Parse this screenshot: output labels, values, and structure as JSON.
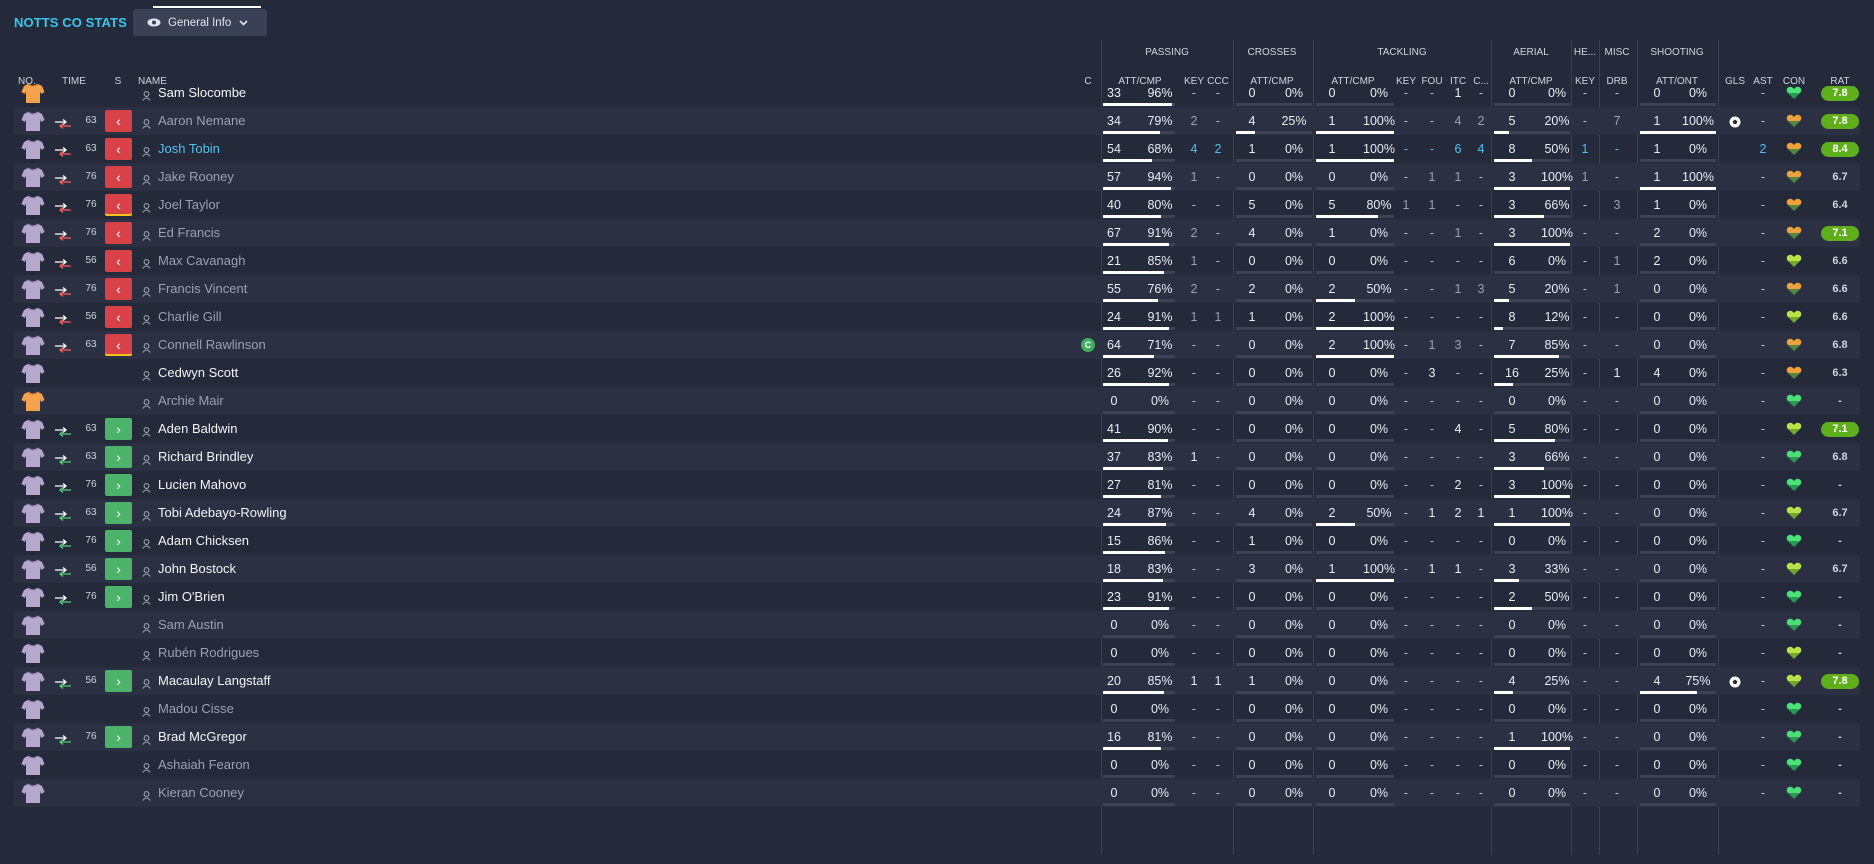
{
  "header": {
    "title": "NOTTS CO STATS",
    "view_label": "General Info"
  },
  "groups": [
    "PASSING",
    "CROSSES",
    "TACKLING",
    "AERIAL",
    "HE...",
    "MISC",
    "SHOOTING"
  ],
  "columns": {
    "no": "NO.",
    "time": "TIME",
    "s": "S",
    "name": "NAME",
    "c": "C",
    "pass_attcmp": "ATT/CMP",
    "key": "KEY",
    "ccc": "CCC",
    "cross_attcmp": "ATT/CMP",
    "tack_attcmp": "ATT/CMP",
    "tkey": "KEY",
    "fou": "FOU",
    "itc": "ITC",
    "cl": "C...",
    "aer_attcmp": "ATT/CMP",
    "hkey": "KEY",
    "drb": "DRB",
    "shot_attont": "ATT/ONT",
    "gls": "GLS",
    "ast": "AST",
    "con": "CON",
    "rat": "RAT"
  },
  "players": [
    {
      "name": "Sam Slocombe",
      "shirt": "orange",
      "status": "active",
      "arrow": "",
      "time": "",
      "sub": "",
      "captain": false,
      "p": [
        "33",
        "96%"
      ],
      "pk": "-",
      "pc": "-",
      "cr": [
        "0",
        "0%"
      ],
      "t": [
        "0",
        "0%"
      ],
      "tk": "-",
      "tf": "-",
      "ti": "1",
      "tc": "-",
      "a": [
        "0",
        "0%"
      ],
      "hk": "-",
      "md": "-",
      "s": [
        "0",
        "0%"
      ],
      "g": "",
      "as": "-",
      "con": "green",
      "rat": "7.8",
      "ratc": true,
      "pf": 0.96,
      "crf": 0,
      "tf2": 0,
      "af": 0,
      "sf": 0
    },
    {
      "name": "Aaron Nemane",
      "shirt": "lilac",
      "status": "dim",
      "arrow": "out",
      "time": "63",
      "sub": "off",
      "captain": false,
      "p": [
        "34",
        "79%"
      ],
      "pk": "2",
      "pc": "-",
      "cr": [
        "4",
        "25%"
      ],
      "t": [
        "1",
        "100%"
      ],
      "tk": "-",
      "tf": "-",
      "ti": "4",
      "tc": "2",
      "a": [
        "5",
        "20%"
      ],
      "hk": "-",
      "md": "7",
      "s": [
        "1",
        "100%"
      ],
      "g": "ball",
      "as": "-",
      "con": "orange",
      "rat": "7.8",
      "ratc": true,
      "pf": 0.79,
      "crf": 0.25,
      "tf2": 1,
      "af": 0.2,
      "sf": 1
    },
    {
      "name": "Josh Tobin",
      "shirt": "lilac",
      "status": "sel",
      "arrow": "out",
      "time": "63",
      "sub": "off",
      "captain": false,
      "p": [
        "54",
        "68%"
      ],
      "pk": "4",
      "pc": "2",
      "cr": [
        "1",
        "0%"
      ],
      "t": [
        "1",
        "100%"
      ],
      "tk": "-",
      "tf": "-",
      "ti": "6",
      "tc": "4",
      "a": [
        "8",
        "50%"
      ],
      "hk": "1",
      "md": "-",
      "s": [
        "1",
        "0%"
      ],
      "g": "",
      "as": "2",
      "con": "orange",
      "rat": "8.4",
      "ratc": true,
      "hl": true,
      "pf": 0.68,
      "crf": 0,
      "tf2": 1,
      "af": 0.5,
      "sf": 0
    },
    {
      "name": "Jake Rooney",
      "shirt": "lilac",
      "status": "dim",
      "arrow": "out",
      "time": "76",
      "sub": "off",
      "captain": false,
      "p": [
        "57",
        "94%"
      ],
      "pk": "1",
      "pc": "-",
      "cr": [
        "0",
        "0%"
      ],
      "t": [
        "0",
        "0%"
      ],
      "tk": "-",
      "tf": "1",
      "ti": "1",
      "tc": "-",
      "a": [
        "3",
        "100%"
      ],
      "hk": "1",
      "md": "-",
      "s": [
        "1",
        "100%"
      ],
      "g": "",
      "as": "-",
      "con": "orange",
      "rat": "6.7",
      "ratc": false,
      "pf": 0.94,
      "crf": 0,
      "tf2": 0,
      "af": 1,
      "sf": 1
    },
    {
      "name": "Joel Taylor",
      "shirt": "lilac",
      "status": "dim",
      "arrow": "out",
      "time": "76",
      "sub": "off yel",
      "captain": false,
      "p": [
        "40",
        "80%"
      ],
      "pk": "-",
      "pc": "-",
      "cr": [
        "5",
        "0%"
      ],
      "t": [
        "5",
        "80%"
      ],
      "tk": "1",
      "tf": "1",
      "ti": "-",
      "tc": "-",
      "a": [
        "3",
        "66%"
      ],
      "hk": "-",
      "md": "3",
      "s": [
        "1",
        "0%"
      ],
      "g": "",
      "as": "-",
      "con": "orange",
      "rat": "6.4",
      "ratc": false,
      "pf": 0.8,
      "crf": 0,
      "tf2": 0.8,
      "af": 0.66,
      "sf": 0
    },
    {
      "name": "Ed Francis",
      "shirt": "lilac",
      "status": "dim",
      "arrow": "out",
      "time": "76",
      "sub": "off",
      "captain": false,
      "p": [
        "67",
        "91%"
      ],
      "pk": "2",
      "pc": "-",
      "cr": [
        "4",
        "0%"
      ],
      "t": [
        "1",
        "0%"
      ],
      "tk": "-",
      "tf": "-",
      "ti": "1",
      "tc": "-",
      "a": [
        "3",
        "100%"
      ],
      "hk": "-",
      "md": "-",
      "s": [
        "2",
        "0%"
      ],
      "g": "",
      "as": "-",
      "con": "orange",
      "rat": "7.1",
      "ratc": true,
      "pf": 0.91,
      "crf": 0,
      "tf2": 0,
      "af": 1,
      "sf": 0
    },
    {
      "name": "Max Cavanagh",
      "shirt": "lilac",
      "status": "dim",
      "arrow": "out",
      "time": "56",
      "sub": "off",
      "captain": false,
      "p": [
        "21",
        "85%"
      ],
      "pk": "1",
      "pc": "-",
      "cr": [
        "0",
        "0%"
      ],
      "t": [
        "0",
        "0%"
      ],
      "tk": "-",
      "tf": "-",
      "ti": "-",
      "tc": "-",
      "a": [
        "6",
        "0%"
      ],
      "hk": "-",
      "md": "1",
      "s": [
        "2",
        "0%"
      ],
      "g": "",
      "as": "-",
      "con": "yellow",
      "rat": "6.6",
      "ratc": false,
      "pf": 0.85,
      "crf": 0,
      "tf2": 0,
      "af": 0,
      "sf": 0
    },
    {
      "name": "Francis Vincent",
      "shirt": "lilac",
      "status": "dim",
      "arrow": "out",
      "time": "76",
      "sub": "off",
      "captain": false,
      "p": [
        "55",
        "76%"
      ],
      "pk": "2",
      "pc": "-",
      "cr": [
        "2",
        "0%"
      ],
      "t": [
        "2",
        "50%"
      ],
      "tk": "-",
      "tf": "-",
      "ti": "1",
      "tc": "3",
      "a": [
        "5",
        "20%"
      ],
      "hk": "-",
      "md": "1",
      "s": [
        "0",
        "0%"
      ],
      "g": "",
      "as": "-",
      "con": "orange",
      "rat": "6.6",
      "ratc": false,
      "pf": 0.76,
      "crf": 0,
      "tf2": 0.5,
      "af": 0.2,
      "sf": 0
    },
    {
      "name": "Charlie Gill",
      "shirt": "lilac",
      "status": "dim",
      "arrow": "out",
      "time": "56",
      "sub": "off",
      "captain": false,
      "p": [
        "24",
        "91%"
      ],
      "pk": "1",
      "pc": "1",
      "cr": [
        "1",
        "0%"
      ],
      "t": [
        "2",
        "100%"
      ],
      "tk": "-",
      "tf": "-",
      "ti": "-",
      "tc": "-",
      "a": [
        "8",
        "12%"
      ],
      "hk": "-",
      "md": "-",
      "s": [
        "0",
        "0%"
      ],
      "g": "",
      "as": "-",
      "con": "yellow",
      "rat": "6.6",
      "ratc": false,
      "pf": 0.91,
      "crf": 0,
      "tf2": 1,
      "af": 0.12,
      "sf": 0
    },
    {
      "name": "Connell Rawlinson",
      "shirt": "lilac",
      "status": "dim",
      "arrow": "out",
      "time": "63",
      "sub": "off yel",
      "captain": true,
      "p": [
        "64",
        "71%"
      ],
      "pk": "-",
      "pc": "-",
      "cr": [
        "0",
        "0%"
      ],
      "t": [
        "2",
        "100%"
      ],
      "tk": "-",
      "tf": "1",
      "ti": "3",
      "tc": "-",
      "a": [
        "7",
        "85%"
      ],
      "hk": "-",
      "md": "-",
      "s": [
        "0",
        "0%"
      ],
      "g": "",
      "as": "-",
      "con": "orange",
      "rat": "6.8",
      "ratc": false,
      "pf": 0.71,
      "crf": 0,
      "tf2": 1,
      "af": 0.85,
      "sf": 0
    },
    {
      "name": "Cedwyn Scott",
      "shirt": "lilac",
      "status": "active",
      "arrow": "",
      "time": "",
      "sub": "",
      "captain": false,
      "p": [
        "26",
        "92%"
      ],
      "pk": "-",
      "pc": "-",
      "cr": [
        "0",
        "0%"
      ],
      "t": [
        "0",
        "0%"
      ],
      "tk": "-",
      "tf": "3",
      "ti": "-",
      "tc": "-",
      "a": [
        "16",
        "25%"
      ],
      "hk": "-",
      "md": "1",
      "s": [
        "4",
        "0%"
      ],
      "g": "",
      "as": "-",
      "con": "orange",
      "rat": "6.3",
      "ratc": false,
      "pf": 0.92,
      "crf": 0,
      "tf2": 0,
      "af": 0.25,
      "sf": 0
    },
    {
      "name": "Archie Mair",
      "shirt": "orange",
      "status": "dim",
      "arrow": "",
      "time": "",
      "sub": "",
      "captain": false,
      "p": [
        "0",
        "0%"
      ],
      "pk": "-",
      "pc": "-",
      "cr": [
        "0",
        "0%"
      ],
      "t": [
        "0",
        "0%"
      ],
      "tk": "-",
      "tf": "-",
      "ti": "-",
      "tc": "-",
      "a": [
        "0",
        "0%"
      ],
      "hk": "-",
      "md": "-",
      "s": [
        "0",
        "0%"
      ],
      "g": "",
      "as": "-",
      "con": "green",
      "rat": "-",
      "ratc": false,
      "pf": 0,
      "crf": 0,
      "tf2": 0,
      "af": 0,
      "sf": 0
    },
    {
      "name": "Aden Baldwin",
      "shirt": "lilac",
      "status": "active",
      "arrow": "in",
      "time": "63",
      "sub": "on",
      "captain": false,
      "p": [
        "41",
        "90%"
      ],
      "pk": "-",
      "pc": "-",
      "cr": [
        "0",
        "0%"
      ],
      "t": [
        "0",
        "0%"
      ],
      "tk": "-",
      "tf": "-",
      "ti": "4",
      "tc": "-",
      "a": [
        "5",
        "80%"
      ],
      "hk": "-",
      "md": "-",
      "s": [
        "0",
        "0%"
      ],
      "g": "",
      "as": "-",
      "con": "yellow",
      "rat": "7.1",
      "ratc": true,
      "pf": 0.9,
      "crf": 0,
      "tf2": 0,
      "af": 0.8,
      "sf": 0
    },
    {
      "name": "Richard Brindley",
      "shirt": "lilac",
      "status": "active",
      "arrow": "in",
      "time": "63",
      "sub": "on",
      "captain": false,
      "p": [
        "37",
        "83%"
      ],
      "pk": "1",
      "pc": "-",
      "cr": [
        "0",
        "0%"
      ],
      "t": [
        "0",
        "0%"
      ],
      "tk": "-",
      "tf": "-",
      "ti": "-",
      "tc": "-",
      "a": [
        "3",
        "66%"
      ],
      "hk": "-",
      "md": "-",
      "s": [
        "0",
        "0%"
      ],
      "g": "",
      "as": "-",
      "con": "green",
      "rat": "6.8",
      "ratc": false,
      "pf": 0.83,
      "crf": 0,
      "tf2": 0,
      "af": 0.66,
      "sf": 0
    },
    {
      "name": "Lucien Mahovo",
      "shirt": "lilac",
      "status": "active",
      "arrow": "in",
      "time": "76",
      "sub": "on",
      "captain": false,
      "p": [
        "27",
        "81%"
      ],
      "pk": "-",
      "pc": "-",
      "cr": [
        "0",
        "0%"
      ],
      "t": [
        "0",
        "0%"
      ],
      "tk": "-",
      "tf": "-",
      "ti": "2",
      "tc": "-",
      "a": [
        "3",
        "100%"
      ],
      "hk": "-",
      "md": "-",
      "s": [
        "0",
        "0%"
      ],
      "g": "",
      "as": "-",
      "con": "green",
      "rat": "-",
      "ratc": false,
      "pf": 0.81,
      "crf": 0,
      "tf2": 0,
      "af": 1,
      "sf": 0
    },
    {
      "name": "Tobi Adebayo-Rowling",
      "shirt": "lilac",
      "status": "active",
      "arrow": "in",
      "time": "63",
      "sub": "on",
      "captain": false,
      "p": [
        "24",
        "87%"
      ],
      "pk": "-",
      "pc": "-",
      "cr": [
        "4",
        "0%"
      ],
      "t": [
        "2",
        "50%"
      ],
      "tk": "-",
      "tf": "1",
      "ti": "2",
      "tc": "1",
      "a": [
        "1",
        "100%"
      ],
      "hk": "-",
      "md": "-",
      "s": [
        "0",
        "0%"
      ],
      "g": "",
      "as": "-",
      "con": "yellow",
      "rat": "6.7",
      "ratc": false,
      "pf": 0.87,
      "crf": 0,
      "tf2": 0.5,
      "af": 1,
      "sf": 0
    },
    {
      "name": "Adam Chicksen",
      "shirt": "lilac",
      "status": "active",
      "arrow": "in",
      "time": "76",
      "sub": "on",
      "captain": false,
      "p": [
        "15",
        "86%"
      ],
      "pk": "-",
      "pc": "-",
      "cr": [
        "1",
        "0%"
      ],
      "t": [
        "0",
        "0%"
      ],
      "tk": "-",
      "tf": "-",
      "ti": "-",
      "tc": "-",
      "a": [
        "0",
        "0%"
      ],
      "hk": "-",
      "md": "-",
      "s": [
        "0",
        "0%"
      ],
      "g": "",
      "as": "-",
      "con": "green",
      "rat": "-",
      "ratc": false,
      "pf": 0.86,
      "crf": 0,
      "tf2": 0,
      "af": 0,
      "sf": 0
    },
    {
      "name": "John Bostock",
      "shirt": "lilac",
      "status": "active",
      "arrow": "in",
      "time": "56",
      "sub": "on",
      "captain": false,
      "p": [
        "18",
        "83%"
      ],
      "pk": "-",
      "pc": "-",
      "cr": [
        "3",
        "0%"
      ],
      "t": [
        "1",
        "100%"
      ],
      "tk": "-",
      "tf": "1",
      "ti": "1",
      "tc": "-",
      "a": [
        "3",
        "33%"
      ],
      "hk": "-",
      "md": "-",
      "s": [
        "0",
        "0%"
      ],
      "g": "",
      "as": "-",
      "con": "yellow",
      "rat": "6.7",
      "ratc": false,
      "pf": 0.83,
      "crf": 0,
      "tf2": 1,
      "af": 0.33,
      "sf": 0
    },
    {
      "name": "Jim O'Brien",
      "shirt": "lilac",
      "status": "active",
      "arrow": "in",
      "time": "76",
      "sub": "on",
      "captain": false,
      "p": [
        "23",
        "91%"
      ],
      "pk": "-",
      "pc": "-",
      "cr": [
        "0",
        "0%"
      ],
      "t": [
        "0",
        "0%"
      ],
      "tk": "-",
      "tf": "-",
      "ti": "-",
      "tc": "-",
      "a": [
        "2",
        "50%"
      ],
      "hk": "-",
      "md": "-",
      "s": [
        "0",
        "0%"
      ],
      "g": "",
      "as": "-",
      "con": "green",
      "rat": "-",
      "ratc": false,
      "pf": 0.91,
      "crf": 0,
      "tf2": 0,
      "af": 0.5,
      "sf": 0
    },
    {
      "name": "Sam Austin",
      "shirt": "lilac",
      "status": "dim",
      "arrow": "",
      "time": "",
      "sub": "",
      "captain": false,
      "p": [
        "0",
        "0%"
      ],
      "pk": "-",
      "pc": "-",
      "cr": [
        "0",
        "0%"
      ],
      "t": [
        "0",
        "0%"
      ],
      "tk": "-",
      "tf": "-",
      "ti": "-",
      "tc": "-",
      "a": [
        "0",
        "0%"
      ],
      "hk": "-",
      "md": "-",
      "s": [
        "0",
        "0%"
      ],
      "g": "",
      "as": "-",
      "con": "green",
      "rat": "-",
      "ratc": false,
      "pf": 0,
      "crf": 0,
      "tf2": 0,
      "af": 0,
      "sf": 0
    },
    {
      "name": "Rubén Rodrigues",
      "shirt": "lilac",
      "status": "dim",
      "arrow": "",
      "time": "",
      "sub": "",
      "captain": false,
      "p": [
        "0",
        "0%"
      ],
      "pk": "-",
      "pc": "-",
      "cr": [
        "0",
        "0%"
      ],
      "t": [
        "0",
        "0%"
      ],
      "tk": "-",
      "tf": "-",
      "ti": "-",
      "tc": "-",
      "a": [
        "0",
        "0%"
      ],
      "hk": "-",
      "md": "-",
      "s": [
        "0",
        "0%"
      ],
      "g": "",
      "as": "-",
      "con": "yellow",
      "rat": "-",
      "ratc": false,
      "pf": 0,
      "crf": 0,
      "tf2": 0,
      "af": 0,
      "sf": 0
    },
    {
      "name": "Macaulay Langstaff",
      "shirt": "lilac",
      "status": "active",
      "arrow": "in",
      "time": "56",
      "sub": "on",
      "captain": false,
      "p": [
        "20",
        "85%"
      ],
      "pk": "1",
      "pc": "1",
      "cr": [
        "1",
        "0%"
      ],
      "t": [
        "0",
        "0%"
      ],
      "tk": "-",
      "tf": "-",
      "ti": "-",
      "tc": "-",
      "a": [
        "4",
        "25%"
      ],
      "hk": "-",
      "md": "-",
      "s": [
        "4",
        "75%"
      ],
      "g": "ball",
      "as": "-",
      "con": "yellow",
      "rat": "7.8",
      "ratc": true,
      "pf": 0.85,
      "crf": 0,
      "tf2": 0,
      "af": 0.25,
      "sf": 0.75
    },
    {
      "name": "Madou Cisse",
      "shirt": "lilac",
      "status": "dim",
      "arrow": "",
      "time": "",
      "sub": "",
      "captain": false,
      "p": [
        "0",
        "0%"
      ],
      "pk": "-",
      "pc": "-",
      "cr": [
        "0",
        "0%"
      ],
      "t": [
        "0",
        "0%"
      ],
      "tk": "-",
      "tf": "-",
      "ti": "-",
      "tc": "-",
      "a": [
        "0",
        "0%"
      ],
      "hk": "-",
      "md": "-",
      "s": [
        "0",
        "0%"
      ],
      "g": "",
      "as": "-",
      "con": "green",
      "rat": "-",
      "ratc": false,
      "pf": 0,
      "crf": 0,
      "tf2": 0,
      "af": 0,
      "sf": 0
    },
    {
      "name": "Brad McGregor",
      "shirt": "lilac",
      "status": "active",
      "arrow": "in",
      "time": "76",
      "sub": "on",
      "captain": false,
      "p": [
        "16",
        "81%"
      ],
      "pk": "-",
      "pc": "-",
      "cr": [
        "0",
        "0%"
      ],
      "t": [
        "0",
        "0%"
      ],
      "tk": "-",
      "tf": "-",
      "ti": "-",
      "tc": "-",
      "a": [
        "1",
        "100%"
      ],
      "hk": "-",
      "md": "-",
      "s": [
        "0",
        "0%"
      ],
      "g": "",
      "as": "-",
      "con": "green",
      "rat": "-",
      "ratc": false,
      "pf": 0.81,
      "crf": 0,
      "tf2": 0,
      "af": 1,
      "sf": 0
    },
    {
      "name": "Ashaiah Fearon",
      "shirt": "lilac",
      "status": "dim",
      "arrow": "",
      "time": "",
      "sub": "",
      "captain": false,
      "p": [
        "0",
        "0%"
      ],
      "pk": "-",
      "pc": "-",
      "cr": [
        "0",
        "0%"
      ],
      "t": [
        "0",
        "0%"
      ],
      "tk": "-",
      "tf": "-",
      "ti": "-",
      "tc": "-",
      "a": [
        "0",
        "0%"
      ],
      "hk": "-",
      "md": "-",
      "s": [
        "0",
        "0%"
      ],
      "g": "",
      "as": "-",
      "con": "green",
      "rat": "-",
      "ratc": false,
      "pf": 0,
      "crf": 0,
      "tf2": 0,
      "af": 0,
      "sf": 0
    },
    {
      "name": "Kieran Cooney",
      "shirt": "lilac",
      "status": "dim",
      "arrow": "",
      "time": "",
      "sub": "",
      "captain": false,
      "p": [
        "0",
        "0%"
      ],
      "pk": "-",
      "pc": "-",
      "cr": [
        "0",
        "0%"
      ],
      "t": [
        "0",
        "0%"
      ],
      "tk": "-",
      "tf": "-",
      "ti": "-",
      "tc": "-",
      "a": [
        "0",
        "0%"
      ],
      "hk": "-",
      "md": "-",
      "s": [
        "0",
        "0%"
      ],
      "g": "",
      "as": "-",
      "con": "green",
      "rat": "-",
      "ratc": false,
      "pf": 0,
      "crf": 0,
      "tf2": 0,
      "af": 0,
      "sf": 0
    }
  ],
  "colors": {
    "accent": "#39c6ee",
    "off": "#d84246",
    "on": "#4cb46a",
    "rating": "#5fae1c",
    "background": "#242a3a"
  }
}
